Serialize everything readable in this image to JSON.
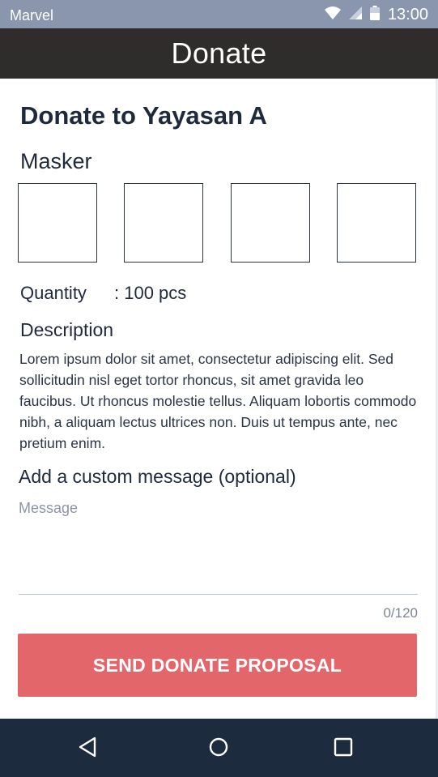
{
  "status_bar": {
    "carrier": "Marvel",
    "time": "13:00",
    "icons": [
      "wifi-icon",
      "signal-icon",
      "battery-icon"
    ]
  },
  "app_bar": {
    "title": "Donate"
  },
  "donation": {
    "heading": "Donate to Yayasan A",
    "item_name": "Masker",
    "thumbnails": [
      "image-placeholder",
      "image-placeholder",
      "image-placeholder",
      "image-placeholder"
    ],
    "quantity_label": "Quantity",
    "quantity_value": ": 100 pcs",
    "description_heading": "Description",
    "description_text": "Lorem ipsum dolor sit amet, consectetur adipiscing elit. Sed sollicitudin nisl eget tortor rhoncus, sit amet gravida leo faucibus. Ut rhoncus molestie tellus. Aliquam lobortis commodo nibh, a aliquam lectus ultrices non. Duis ut tempus ante, nec pretium enim."
  },
  "custom_message": {
    "heading": "Add a custom message (optional)",
    "placeholder": "Message",
    "value": "",
    "counter": "0/120"
  },
  "actions": {
    "send_label": "SEND DONATE PROPOSAL"
  },
  "colors": {
    "status_bar": "#8a96ad",
    "app_bar": "#2e2d2b",
    "primary_button": "#e2666a",
    "nav_bar": "#1d2b3f"
  },
  "nav_bar": {
    "icons": [
      "back-icon",
      "home-icon",
      "recents-icon"
    ]
  }
}
